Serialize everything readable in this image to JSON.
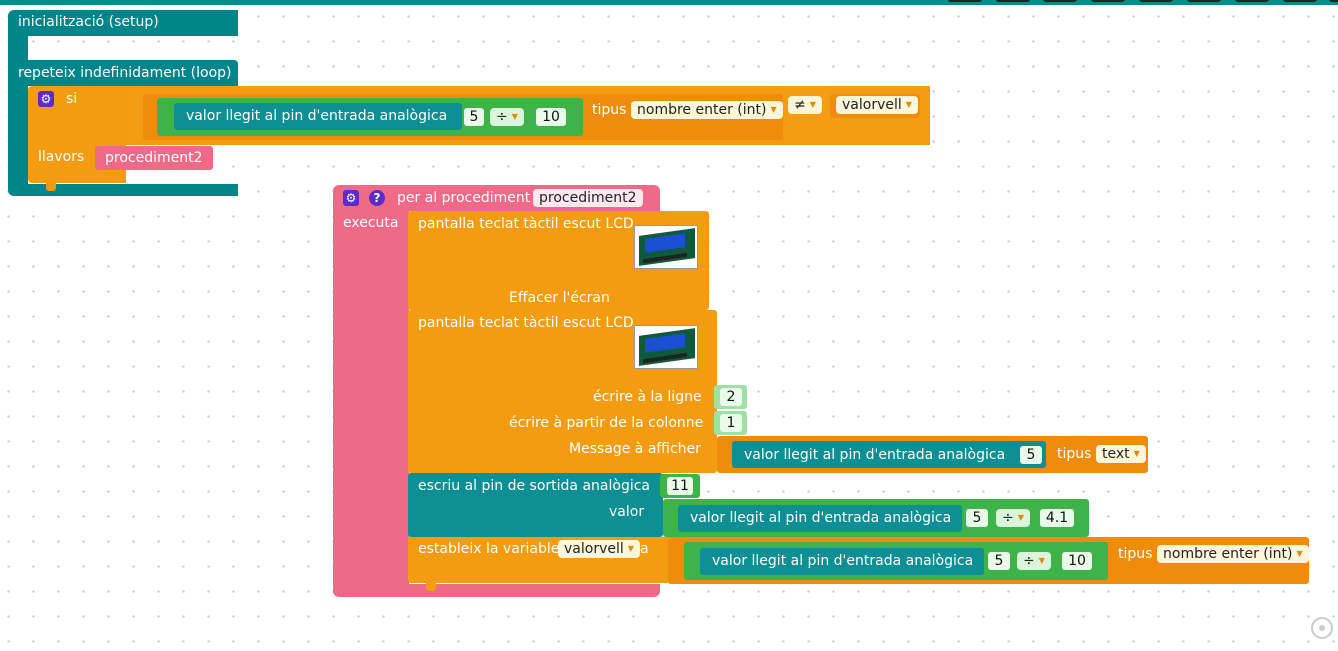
{
  "setup_block": {
    "label": "inicialització (setup)"
  },
  "loop_block": {
    "label": "repeteix indefinidament (loop)"
  },
  "if_block": {
    "if_label": "si",
    "then_label": "llavors",
    "analog_read_label": "valor llegit al pin d'entrada analògica",
    "pin": "5",
    "operator": "÷",
    "divisor": "10",
    "type_label": "tipus",
    "type_value": "nombre enter (int)",
    "compare_op": "≠",
    "variable": "valorvell",
    "call_procedure": "procediment2"
  },
  "procedure_block": {
    "header_label": "per al procediment",
    "name": "procediment2",
    "do_label": "executa"
  },
  "lcd_clear": {
    "label": "pantalla teclat tàctil escut LCD",
    "action": "Effacer l'écran"
  },
  "lcd_print": {
    "label": "pantalla teclat tàctil escut LCD",
    "line_label": "écrire à la ligne",
    "line_value": "2",
    "col_label": "écrire à partir de la colonne",
    "col_value": "1",
    "msg_label": "Message à afficher",
    "analog_read_label": "valor llegit al pin d'entrada analògica",
    "pin": "5",
    "type_label": "tipus",
    "type_value": "text"
  },
  "analog_write": {
    "label": "escriu al pin de sortida analògica",
    "pin": "11",
    "value_label": "valor",
    "analog_read_label": "valor llegit al pin d'entrada analògica",
    "read_pin": "5",
    "operator": "÷",
    "divisor": "4.1"
  },
  "set_var": {
    "label": "estableix la variable",
    "variable": "valorvell",
    "to_label": "a",
    "analog_read_label": "valor llegit al pin d'entrada analògica",
    "pin": "5",
    "operator": "÷",
    "divisor": "10",
    "type_label": "tipus",
    "type_value": "nombre enter (int)"
  },
  "colors": {
    "teal": "#00868a",
    "orange": "#ee9a10",
    "pink": "#ee6a86",
    "green": "#3db34a",
    "purple": "#5b2ccc"
  },
  "icons": [
    "gear-icon",
    "help-icon",
    "lcd-shield-image",
    "recenter-icon",
    "dropdown-arrow-icon"
  ]
}
